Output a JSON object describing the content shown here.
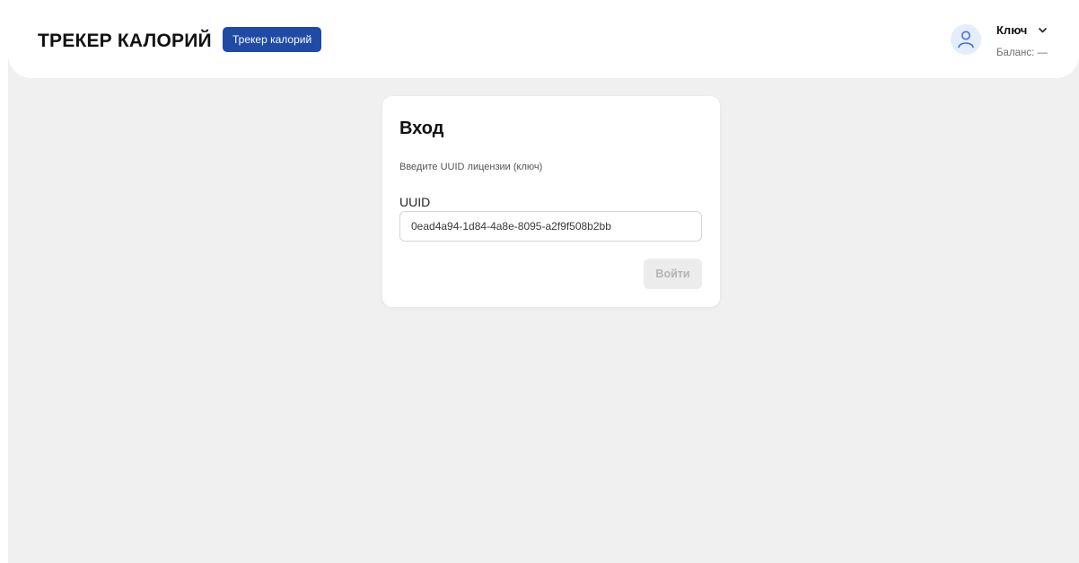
{
  "header": {
    "brand": "ТРЕКЕР КАЛОРИЙ",
    "nav_button": "Трекер калорий",
    "user_name": "Ключ",
    "balance": "Баланс: —"
  },
  "login": {
    "title": "Вход",
    "subtitle": "Введите UUID лицензии (ключ)",
    "field_label": "UUID",
    "field_value": "0ead4a94-1d84-4a8e-8095-a2f9f508b2bb",
    "submit_label": "Войти"
  },
  "icons": {
    "avatar": "user-icon",
    "user_menu_toggle": "chevron-down-icon"
  },
  "colors": {
    "accent": "#1f4aa6",
    "page_background": "#f0f0f0",
    "surface": "#ffffff",
    "avatar_background": "#e4edfb",
    "avatar_stroke": "#3f72d6",
    "button_disabled_background": "#ececec",
    "button_disabled_text": "#b4b4b4"
  }
}
